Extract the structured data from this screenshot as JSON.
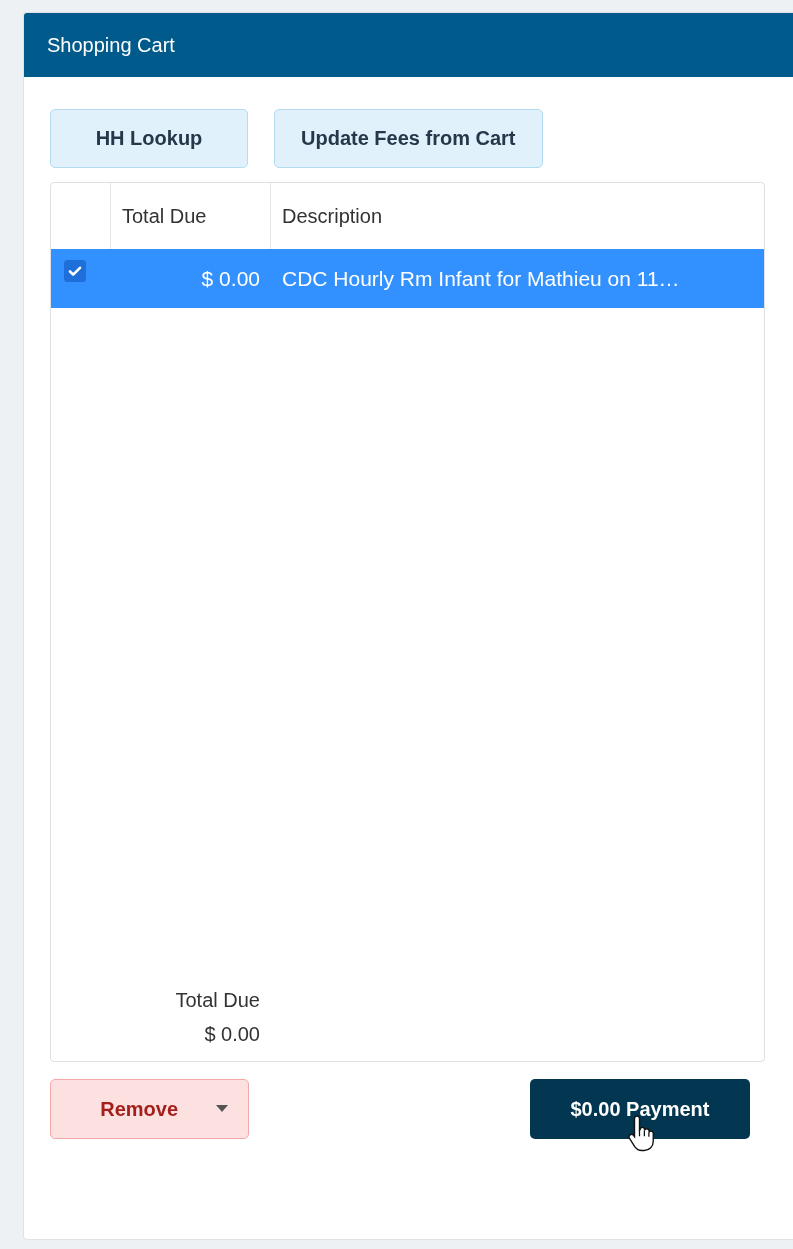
{
  "panel": {
    "title": "Shopping Cart"
  },
  "actions": [
    {
      "label": "HH Lookup"
    },
    {
      "label": "Update Fees from Cart"
    }
  ],
  "table": {
    "columns": [
      "Total Due",
      "Description"
    ],
    "rows": [
      {
        "checked": true,
        "selected": true,
        "total_due": "$ 0.00",
        "description": "CDC Hourly Rm Infant for Mathieu on 11…"
      }
    ],
    "footer": {
      "label": "Total Due",
      "value": "$ 0.00"
    }
  },
  "remove_button": {
    "label": "Remove"
  },
  "payment_button": {
    "label": "$0.00 Payment"
  }
}
